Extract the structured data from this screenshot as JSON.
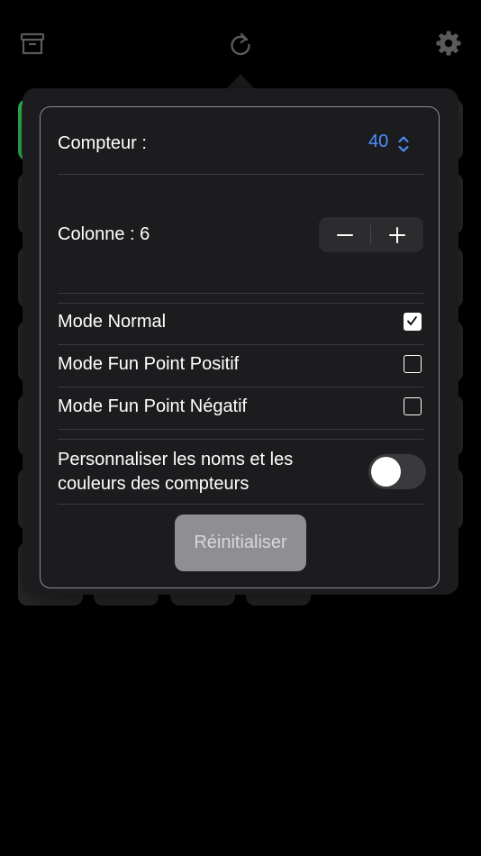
{
  "toolbar": {
    "archive_icon": "archivebox-icon",
    "refresh_icon": "arrow-clockwise-icon",
    "settings_icon": "gear-icon"
  },
  "settings": {
    "counter_label": "Compteur :",
    "counter_value": "40",
    "column_label": "Colonne : 6",
    "modes": [
      {
        "label": "Mode Normal",
        "checked": true
      },
      {
        "label": "Mode Fun Point Positif",
        "checked": false
      },
      {
        "label": "Mode Fun Point Négatif",
        "checked": false
      }
    ],
    "customize_line1": "Personnaliser les noms et les",
    "customize_line2": "couleurs des compteurs",
    "customize_on": false,
    "reset_label": "Réinitialiser"
  },
  "colors": {
    "accent": "#4a90ff",
    "tile_highlight": "#34c759",
    "popover_bg": "#1c1c1e",
    "button_bg": "#8e8e93"
  }
}
